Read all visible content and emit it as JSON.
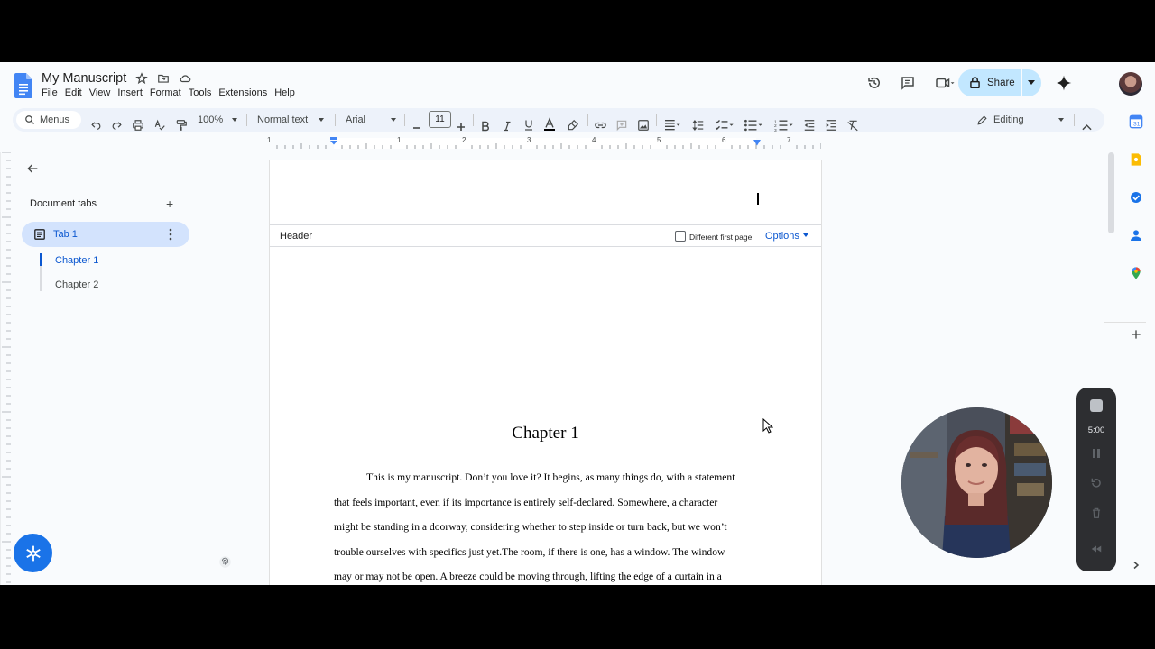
{
  "document": {
    "title": "My Manuscript"
  },
  "menu": [
    "File",
    "Edit",
    "View",
    "Insert",
    "Format",
    "Tools",
    "Extensions",
    "Help"
  ],
  "toolbar": {
    "menus_label": "Menus",
    "zoom": "100%",
    "style": "Normal text",
    "font": "Arial",
    "font_size": "11",
    "mode": "Editing"
  },
  "share": {
    "label": "Share"
  },
  "ruler": {
    "numbers": [
      "1",
      "1",
      "2",
      "3",
      "4",
      "5",
      "6",
      "7"
    ]
  },
  "sidebar": {
    "heading": "Document tabs",
    "add": "+",
    "tab": "Tab 1",
    "chapters": [
      "Chapter 1",
      "Chapter 2"
    ]
  },
  "page": {
    "header_label": "Header",
    "different_first_page": "Different first page",
    "options": "Options",
    "chapter_heading": "Chapter 1",
    "body_lines": [
      "This is my manuscript. Don’t you love it? It begins, as many things do, with a statement",
      "that feels important, even if its importance is entirely self-declared. Somewhere, a character",
      "might be standing in a doorway, considering whether to step inside or turn back, but we won’t",
      "trouble ourselves with specifics just yet.The room, if there is one, has a window. The window",
      "may or may not be open. A breeze could be moving through, lifting the edge of a curtain in a"
    ]
  },
  "recorder": {
    "time": "5:00"
  },
  "colors": {
    "accent": "#0b57d0",
    "toolbar_bg": "#edf2fa",
    "share_bg": "#c2e7ff",
    "tab_active_bg": "#d3e3fd"
  }
}
